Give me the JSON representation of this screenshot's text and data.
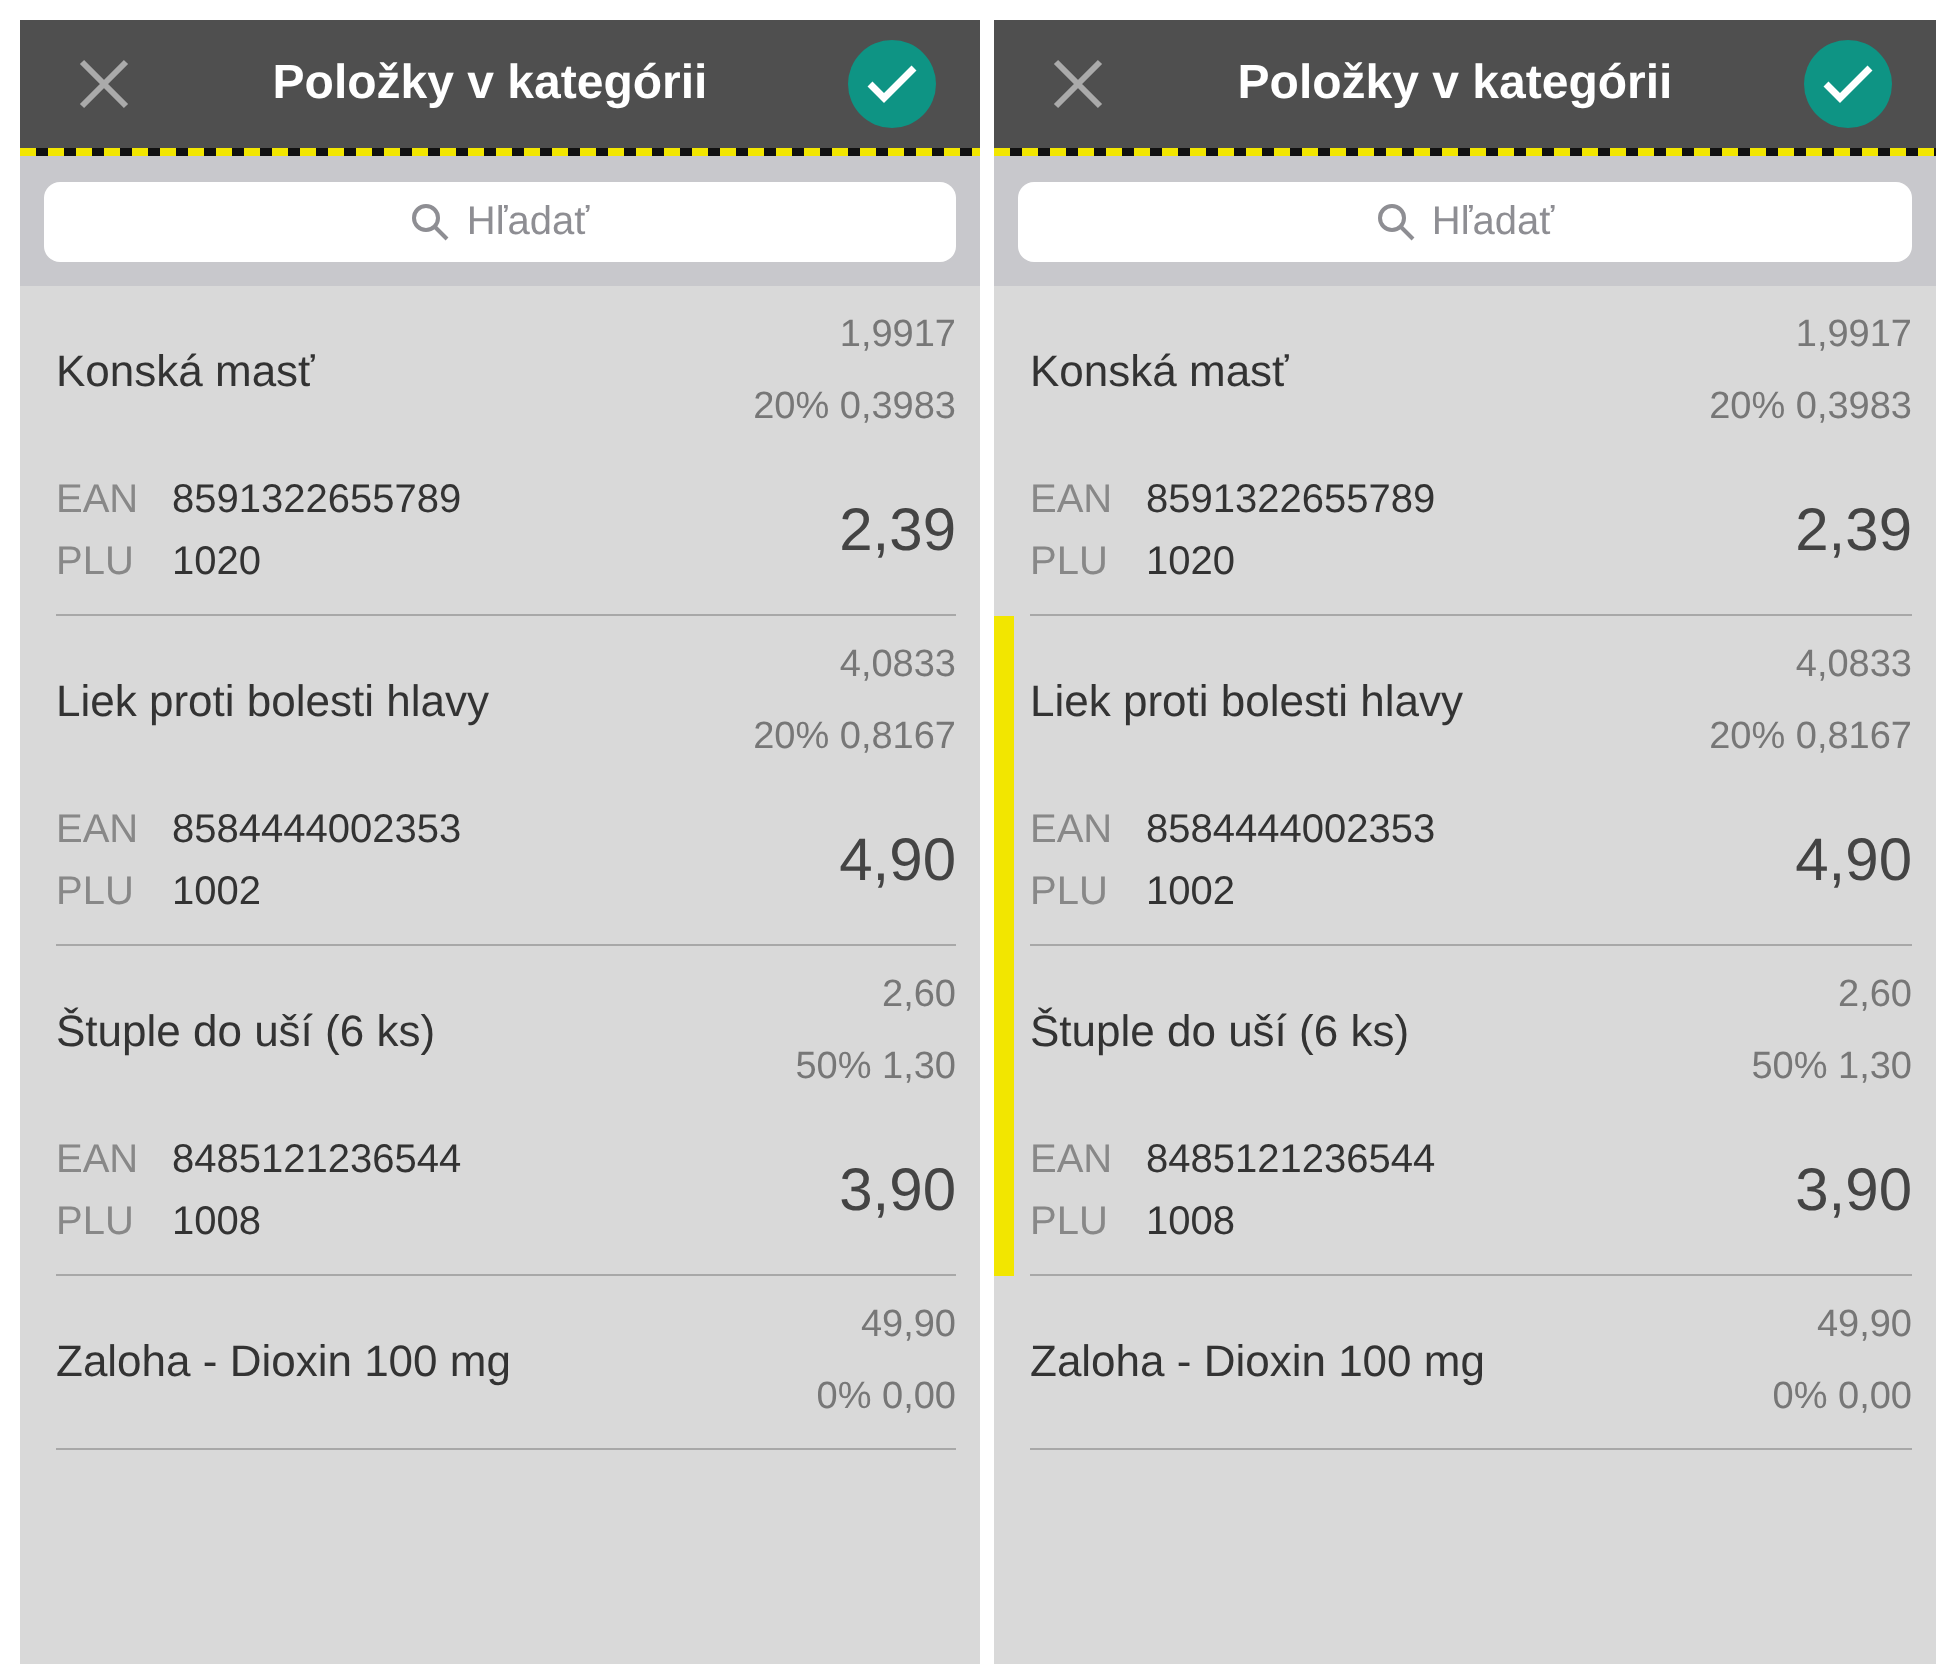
{
  "panels": [
    {
      "title": "Položky v kategórii",
      "search": {
        "placeholder": "Hľadať"
      },
      "items": [
        {
          "name": "Konská masť",
          "net": "1,9917",
          "vat": "20% 0,3983",
          "ean_label": "EAN",
          "ean": "8591322655789",
          "plu_label": "PLU",
          "plu": "1020",
          "price": "2,39",
          "selected": false
        },
        {
          "name": "Liek proti bolesti hlavy",
          "net": "4,0833",
          "vat": "20% 0,8167",
          "ean_label": "EAN",
          "ean": "8584444002353",
          "plu_label": "PLU",
          "plu": "1002",
          "price": "4,90",
          "selected": false
        },
        {
          "name": "Štuple do uší (6 ks)",
          "net": "2,60",
          "vat": "50% 1,30",
          "ean_label": "EAN",
          "ean": "8485121236544",
          "plu_label": "PLU",
          "plu": "1008",
          "price": "3,90",
          "selected": false
        },
        {
          "name": "Zaloha - Dioxin 100 mg",
          "net": "49,90",
          "vat": "0% 0,00",
          "selected": false
        }
      ]
    },
    {
      "title": "Položky v kategórii",
      "search": {
        "placeholder": "Hľadať"
      },
      "items": [
        {
          "name": "Konská masť",
          "net": "1,9917",
          "vat": "20% 0,3983",
          "ean_label": "EAN",
          "ean": "8591322655789",
          "plu_label": "PLU",
          "plu": "1020",
          "price": "2,39",
          "selected": false
        },
        {
          "name": "Liek proti bolesti hlavy",
          "net": "4,0833",
          "vat": "20% 0,8167",
          "ean_label": "EAN",
          "ean": "8584444002353",
          "plu_label": "PLU",
          "plu": "1002",
          "price": "4,90",
          "selected": true
        },
        {
          "name": "Štuple do uší (6 ks)",
          "net": "2,60",
          "vat": "50% 1,30",
          "ean_label": "EAN",
          "ean": "8485121236544",
          "plu_label": "PLU",
          "plu": "1008",
          "price": "3,90",
          "selected": true
        },
        {
          "name": "Zaloha - Dioxin 100 mg",
          "net": "49,90",
          "vat": "0% 0,00",
          "selected": false
        }
      ]
    }
  ]
}
